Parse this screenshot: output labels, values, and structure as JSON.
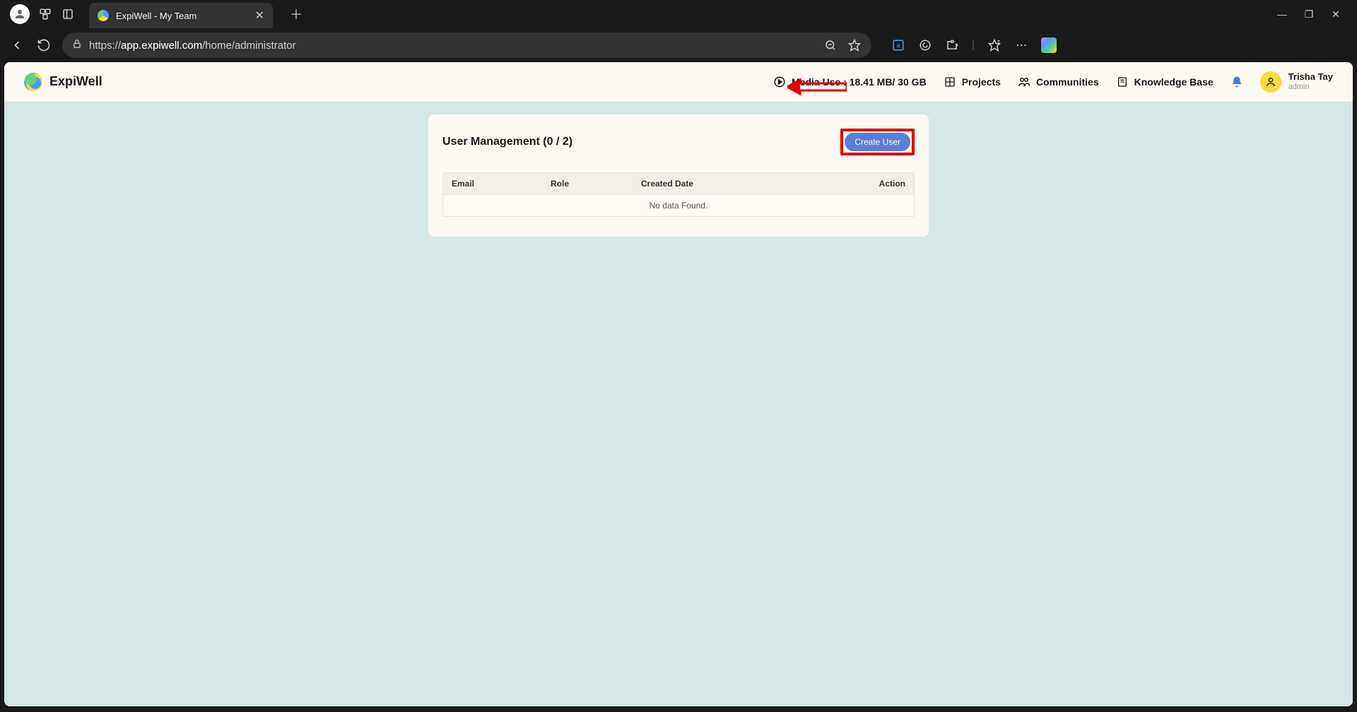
{
  "browser": {
    "tab_title": "ExpiWell - My Team",
    "url_prefix": "https://",
    "url_host": "app.expiwell.com",
    "url_path": "/home/administrator"
  },
  "header": {
    "brand": "ExpiWell",
    "media_use_label": "Media Use : 18.41 MB/ 30 GB",
    "nav": {
      "projects": "Projects",
      "communities": "Communities",
      "knowledge_base": "Knowledge Base"
    },
    "user": {
      "name": "Trisha Tay",
      "role": "admin"
    }
  },
  "card": {
    "title": "User Management (0 / 2)",
    "create_button": "Create User",
    "columns": {
      "email": "Email",
      "role": "Role",
      "created_date": "Created Date",
      "action": "Action"
    },
    "empty_message": "No data Found."
  }
}
